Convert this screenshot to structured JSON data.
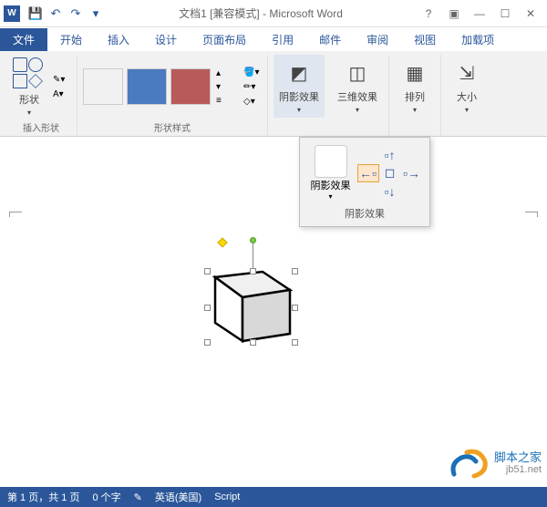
{
  "title": "文档1 [兼容模式] - Microsoft Word",
  "tabs": {
    "file": "文件",
    "home": "开始",
    "insert": "插入",
    "design": "设计",
    "layout": "页面布局",
    "references": "引用",
    "mail": "邮件",
    "review": "审阅",
    "view": "视图",
    "addins": "加载项"
  },
  "ribbon": {
    "shape_label": "形状",
    "insert_shape_group": "插入形状",
    "shape_styles_group": "形状样式",
    "shadow_btn": "阴影效果",
    "threed_btn": "三维效果",
    "arrange_btn": "排列",
    "size_btn": "大小",
    "colors": {
      "s1": "#1a1a1a",
      "s2": "#4a7abf",
      "s3": "#b85a5a"
    }
  },
  "dropdown": {
    "shadow_btn": "阴影效果",
    "panel_label": "阴影效果"
  },
  "status": {
    "page": "第 1 页，共 1 页",
    "words": "0 个字",
    "lang": "英语(美国)",
    "ime": "Script"
  },
  "watermark": {
    "line1": "脚本之家",
    "line2": "jb51.net"
  }
}
